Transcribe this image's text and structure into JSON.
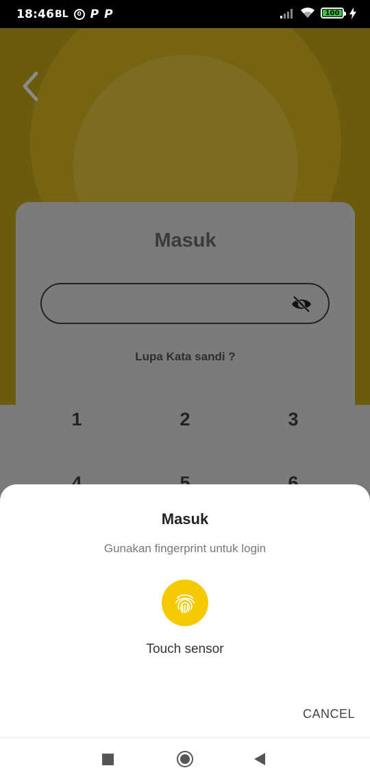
{
  "status_bar": {
    "time": "18:46",
    "carrier_tag": "BL",
    "data_saver_glyph": "0",
    "app_glyph_1": "P",
    "app_glyph_2": "P",
    "battery": "100",
    "icons": [
      "signal-icon",
      "wifi-icon",
      "battery-icon",
      "charging-icon"
    ]
  },
  "login": {
    "title": "Masuk",
    "forgot_password": "Lupa Kata sandi ?",
    "keypad_row1": [
      "1",
      "2",
      "3"
    ],
    "keypad_row2_partial": [
      "4",
      "5",
      "6"
    ]
  },
  "dialog": {
    "title": "Masuk",
    "subtitle": "Gunakan fingerprint untuk login",
    "sensor_label": "Touch sensor",
    "cancel_label": "CANCEL",
    "accent_color": "#f6c800"
  },
  "colors": {
    "brand_yellow": "#f6c800",
    "dim_overlay": "#7a7a7a"
  }
}
